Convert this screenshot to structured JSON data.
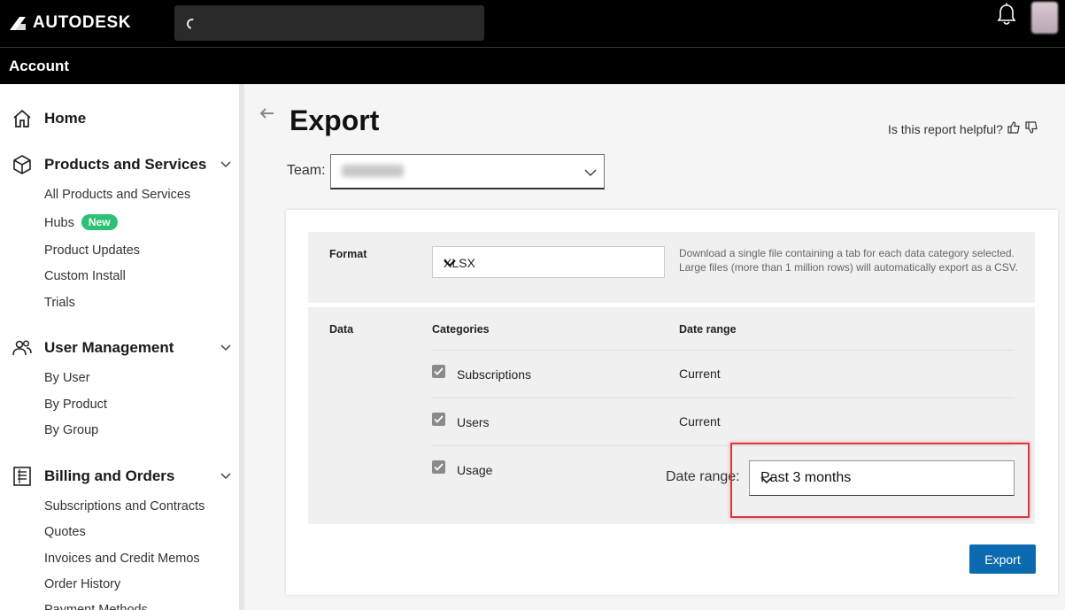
{
  "header": {
    "brand": "AUTODESK"
  },
  "account_bar": {
    "title": "Account"
  },
  "sidebar": {
    "home": "Home",
    "products": {
      "title": "Products and Services",
      "items": [
        "All Products and Services",
        "Hubs",
        "Product Updates",
        "Custom Install",
        "Trials"
      ],
      "hubs_badge": "New"
    },
    "users": {
      "title": "User Management",
      "items": [
        "By User",
        "By Product",
        "By Group"
      ]
    },
    "billing": {
      "title": "Billing and Orders",
      "items": [
        "Subscriptions and Contracts",
        "Quotes",
        "Invoices and Credit Memos",
        "Order History",
        "Payment Methods"
      ]
    }
  },
  "page": {
    "title": "Export",
    "helpful": "Is this report helpful?",
    "team_label": "Team:"
  },
  "format": {
    "label": "Format",
    "value": "XLSX",
    "help": "Download a single file containing a tab for each data category selected. Large files (more than 1 million rows) will automatically export as a CSV."
  },
  "data": {
    "label": "Data",
    "col_categories": "Categories",
    "col_range": "Date range",
    "rows": [
      {
        "category": "Subscriptions",
        "range": "Current",
        "checked": true
      },
      {
        "category": "Users",
        "range": "Current",
        "checked": true
      },
      {
        "category": "Usage",
        "checked": true
      }
    ],
    "range_label": "Date range:",
    "range_value": "Past 3 months"
  },
  "export_button": "Export",
  "colors": {
    "accent": "#0c6ab0",
    "highlight": "#d9383e",
    "badge": "#2bc275"
  }
}
